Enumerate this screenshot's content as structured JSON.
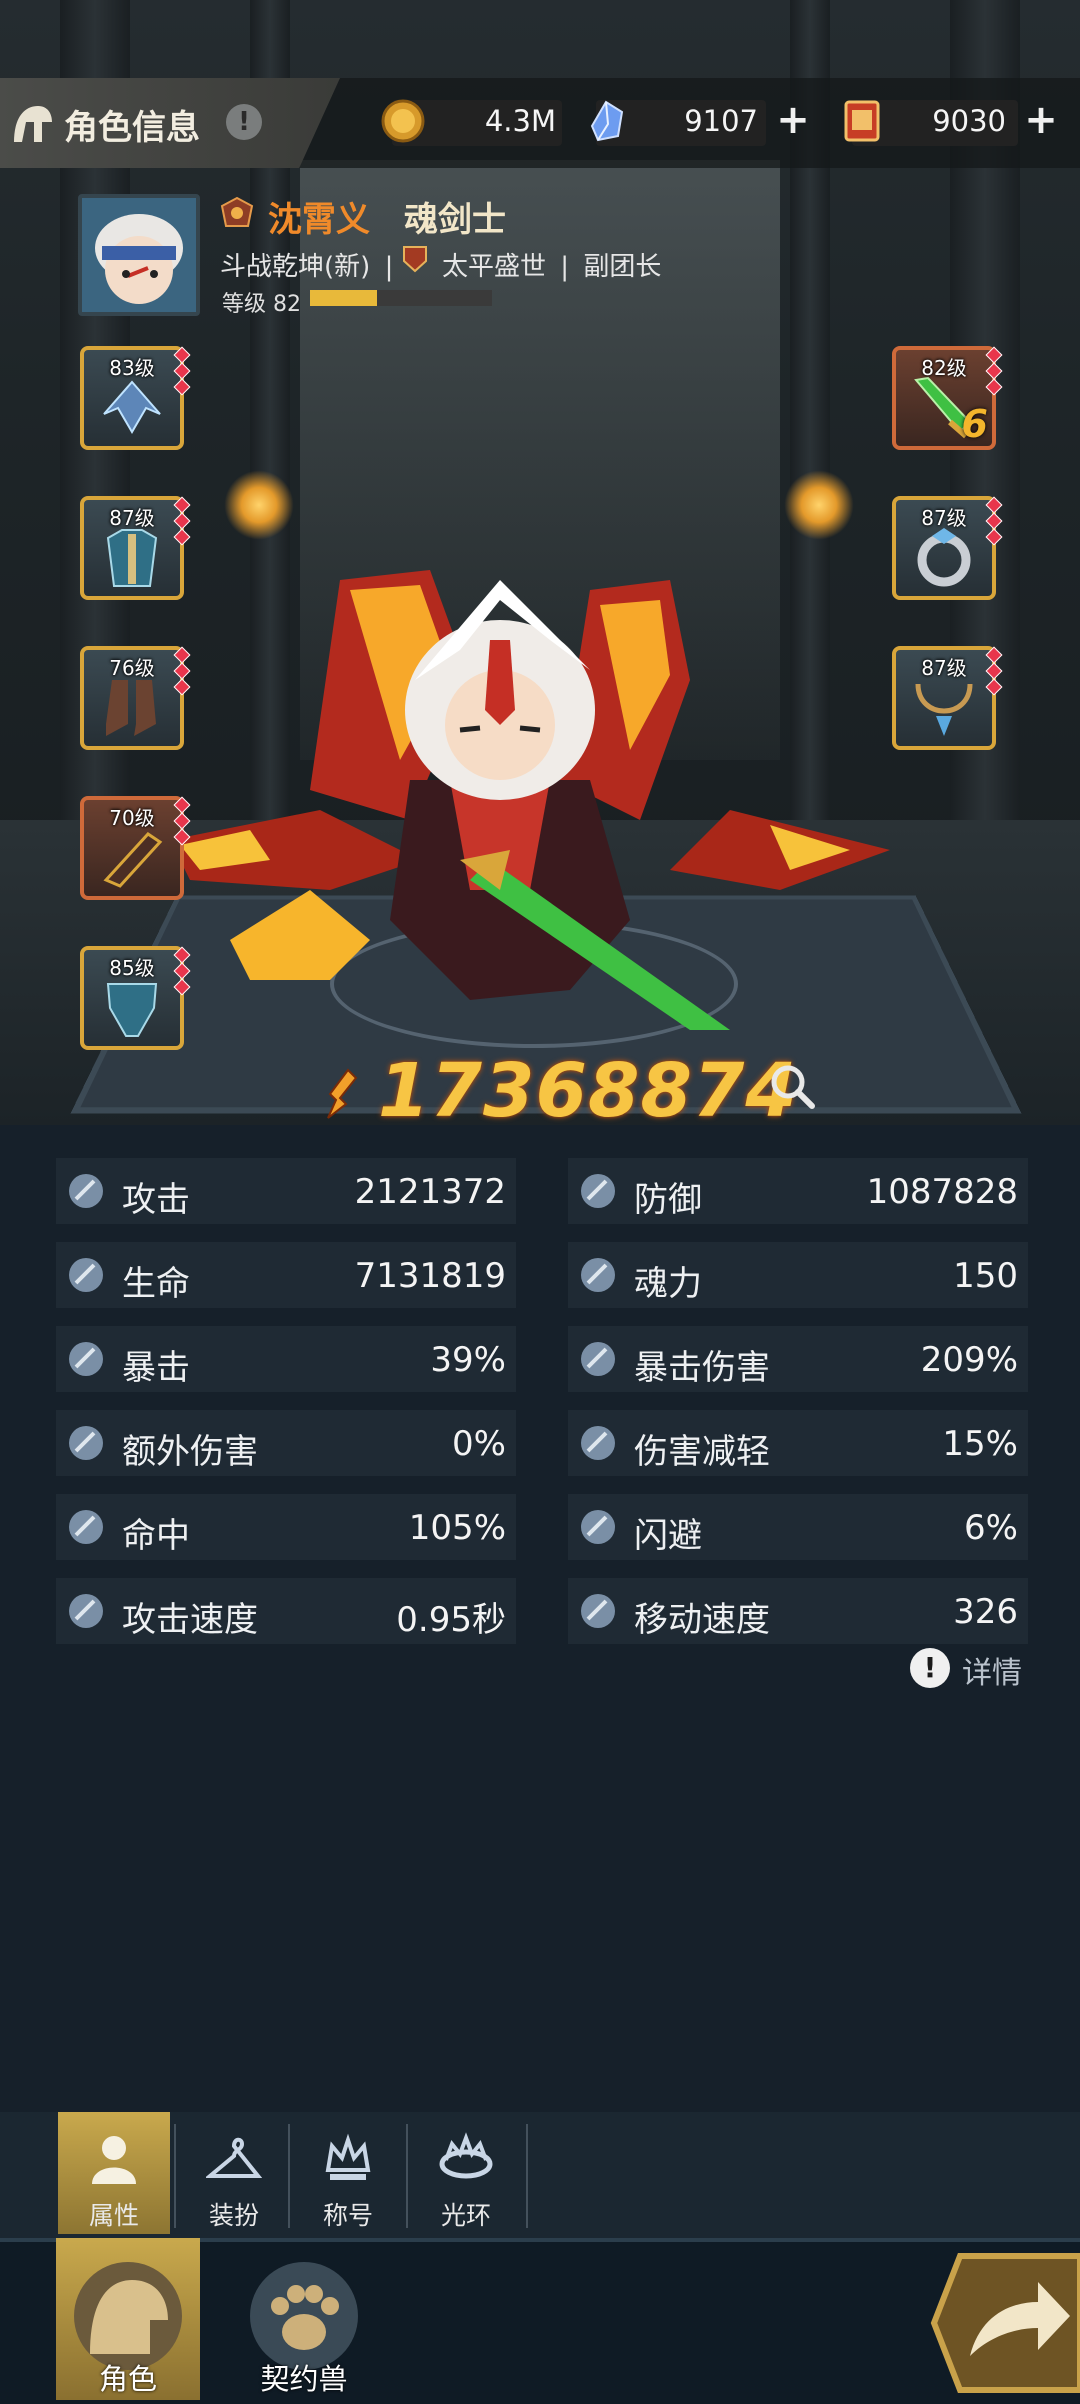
{
  "header": {
    "title": "角色信息",
    "info_glyph": "!",
    "resources": [
      {
        "icon": "gold-coin-icon",
        "value": "4.3M"
      },
      {
        "icon": "blue-crystal-icon",
        "value": "9107"
      },
      {
        "icon": "red-ticket-icon",
        "value": "9030"
      }
    ],
    "plus_glyph": "+"
  },
  "character": {
    "name": "沈霄义",
    "class": "魂剑士",
    "server": "斗战乾坤(新)",
    "guild": "太平盛世",
    "guild_role": "副团长",
    "level_label": "等级 82",
    "level_progress": 0.37,
    "name_color": "#f08a2a"
  },
  "equipment": {
    "left": [
      {
        "level": "83级",
        "icon": "shoulder-armor-icon",
        "quality": "gold"
      },
      {
        "level": "87级",
        "icon": "chest-armor-icon",
        "quality": "gold"
      },
      {
        "level": "76级",
        "icon": "boots-icon",
        "quality": "gold"
      },
      {
        "level": "70级",
        "icon": "bracer-icon",
        "quality": "red"
      },
      {
        "level": "85级",
        "icon": "leg-armor-icon",
        "quality": "gold"
      }
    ],
    "right": [
      {
        "level": "82级",
        "icon": "green-sword-icon",
        "quality": "red",
        "enhance": "6"
      },
      {
        "level": "87级",
        "icon": "ring-icon",
        "quality": "gold"
      },
      {
        "level": "87级",
        "icon": "necklace-icon",
        "quality": "gold"
      }
    ]
  },
  "power": {
    "value": "17368874",
    "icon": "power-icon",
    "search_icon": "search-icon"
  },
  "stats": [
    {
      "label": "攻击",
      "value": "2121372",
      "icon": "attack-icon"
    },
    {
      "label": "防御",
      "value": "1087828",
      "icon": "defense-icon"
    },
    {
      "label": "生命",
      "value": "7131819",
      "icon": "life-icon"
    },
    {
      "label": "魂力",
      "value": "150",
      "icon": "soul-power-icon"
    },
    {
      "label": "暴击",
      "value": "39%",
      "icon": "crit-icon"
    },
    {
      "label": "暴击伤害",
      "value": "209%",
      "icon": "crit-damage-icon"
    },
    {
      "label": "额外伤害",
      "value": "0%",
      "icon": "extra-damage-icon"
    },
    {
      "label": "伤害减轻",
      "value": "15%",
      "icon": "damage-reduction-icon"
    },
    {
      "label": "命中",
      "value": "105%",
      "icon": "accuracy-icon"
    },
    {
      "label": "闪避",
      "value": "6%",
      "icon": "dodge-icon"
    },
    {
      "label": "攻击速度",
      "value": "0.95秒",
      "icon": "attack-speed-icon"
    },
    {
      "label": "移动速度",
      "value": "326",
      "icon": "move-speed-icon"
    }
  ],
  "details": {
    "label": "详情",
    "glyph": "!"
  },
  "subtabs": [
    {
      "label": "属性",
      "icon": "person-icon",
      "active": true
    },
    {
      "label": "装扮",
      "icon": "hanger-icon",
      "active": false
    },
    {
      "label": "称号",
      "icon": "crown-icon",
      "active": false
    },
    {
      "label": "光环",
      "icon": "halo-icon",
      "active": false
    }
  ],
  "bottom_nav": [
    {
      "label": "角色",
      "icon": "character-icon",
      "active": true
    },
    {
      "label": "契约兽",
      "icon": "paw-icon",
      "active": false
    }
  ],
  "next_icon": "arrow-right-icon",
  "colors": {
    "accent_gold": "#e8b93a",
    "power": "#f7c544",
    "stat_row": "#1f2a34"
  }
}
